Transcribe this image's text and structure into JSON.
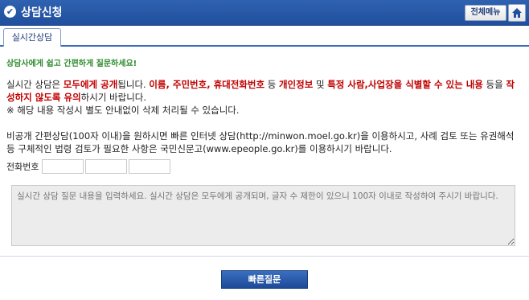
{
  "header": {
    "title": "상담신청",
    "all_menu_label": "전체메뉴",
    "home_icon": "home-icon",
    "check_icon": "check-circle-icon"
  },
  "tabs": [
    {
      "label": "실시간상담",
      "active": true
    }
  ],
  "notice": {
    "headline": "상담사에게 쉽고 간편하게 질문하세요!",
    "p1_a": "실시간 상담은 ",
    "p1_b": "모두에게 공개",
    "p1_c": "됩니다. ",
    "p1_d": "이름, 주민번호, 휴대전화번호",
    "p1_e": " 등 ",
    "p1_f": "개인정보",
    "p1_g": " 및 ",
    "p1_h": "특정 사람,사업장을 식별할 수 있는 내용",
    "p1_i": " 등을 ",
    "p1_j": "작성하지 않도록 유의",
    "p1_k": "하시기 바랍니다.",
    "p1_note": "※ 해당 내용 작성시 별도 안내없이 삭제 처리될 수 있습니다.",
    "p2": "비공개 간편상담(100자 이내)을 원하시면 빠른 인터넷 상담(http://minwon.moel.go.kr)을 이용하시고, 사례 검토 또는 유권해석 등 구체적인 법령 검토가 필요한 사항은 국민신문고(www.epeople.go.kr)를 이용하시기 바랍니다."
  },
  "form": {
    "phone_label": "전화번호",
    "phone_1": "",
    "phone_2": "",
    "phone_3": "",
    "question_placeholder": "실시간 상담 질문 내용을 입력하세요. 실시간 상담은 모두에게 공개되며, 글자 수 제한이 있으니 100자 이내로 작성하여 주시기 바랍니다.",
    "submit_label": "빠른질문"
  },
  "colors": {
    "header_blue": "#1f4f9e",
    "warning_red": "#c00000",
    "headline_green": "#2e8b2e"
  }
}
